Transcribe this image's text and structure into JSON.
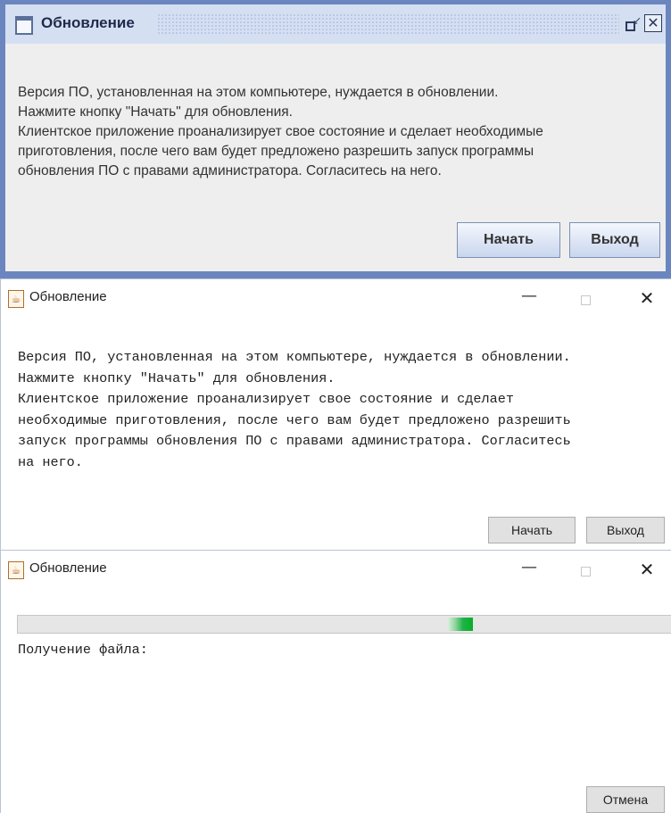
{
  "dialog1": {
    "title": "Обновление",
    "message_lines": [
      "Версия ПО, установленная на этом компьютере, нуждается в обновлении.",
      "Нажмите кнопку \"Начать\" для обновления.",
      "Клиентское приложение проанализирует свое состояние и сделает необходимые",
      "приготовления, после чего вам будет предложено разрешить запуск программы",
      "обновления ПО с правами администратора. Согласитесь на него."
    ],
    "start_label": "Начать",
    "exit_label": "Выход",
    "close_glyph": "✕"
  },
  "dialog2": {
    "title": "Обновление",
    "minimize_glyph": "—",
    "close_glyph": "✕",
    "message_lines": [
      "Версия ПО, установленная на этом компьютере, нуждается в обновлении.",
      "Нажмите кнопку \"Начать\" для обновления.",
      "Клиентское приложение проанализирует свое состояние и сделает",
      "необходимые приготовления, после чего вам будет предложено разрешить",
      "запуск программы обновления ПО с правами администратора. Согласитесь",
      "на него."
    ],
    "start_label": "Начать",
    "exit_label": "Выход"
  },
  "dialog3": {
    "title": "Обновление",
    "minimize_glyph": "—",
    "close_glyph": "✕",
    "status_label": "Получение файла:",
    "progress_state": "indeterminate",
    "cancel_label": "Отмена"
  },
  "colors": {
    "metal_frame": "#6b86bf",
    "metal_title": "#d4dff2",
    "progress_green": "#06b025"
  },
  "icons": {
    "dialog1_title": "window-icon",
    "dialog1_restore": "restore-icon",
    "dialog1_close": "close-icon",
    "dialog2_app": "java-icon",
    "dialog3_app": "java-icon"
  }
}
